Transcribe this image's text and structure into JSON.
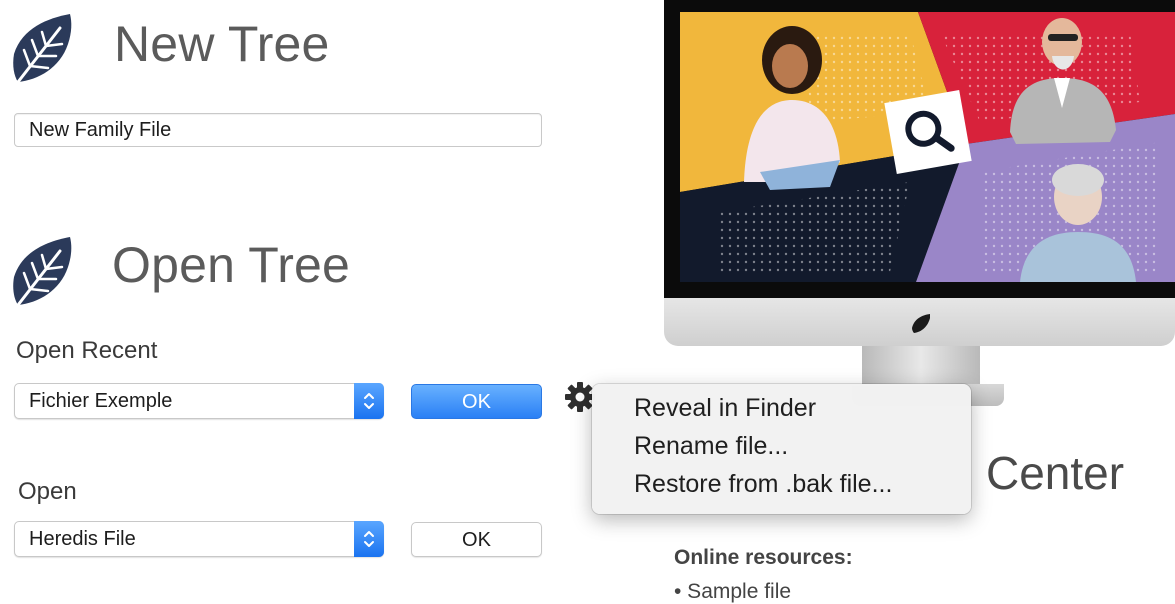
{
  "new_tree": {
    "title": "New Tree",
    "file_name_value": "New Family File"
  },
  "open_tree": {
    "title": "Open Tree",
    "open_recent_label": "Open Recent",
    "recent_selected": "Fichier Exemple",
    "recent_ok_label": "OK",
    "open_label": "Open",
    "open_selected": "Heredis File",
    "open_ok_label": "OK"
  },
  "context_menu": {
    "items": [
      "Reveal in Finder",
      "Rename file...",
      "Restore from .bak file..."
    ]
  },
  "help": {
    "center_partial": "Center",
    "resources_title": "Online resources:",
    "resources_item_partial": "• Sample file"
  },
  "colors": {
    "icon_navy": "#2b3a5a",
    "accent_blue": "#2a80f5",
    "panel_yellow": "#f1b73c",
    "panel_red": "#d8223b",
    "panel_purple": "#9a86c8",
    "panel_dark": "#121a2c"
  },
  "icons": {
    "leaf": "leaf-icon",
    "gear": "gear-icon",
    "stepper": "chevron-up-down-icon",
    "search": "magnifier-icon"
  }
}
